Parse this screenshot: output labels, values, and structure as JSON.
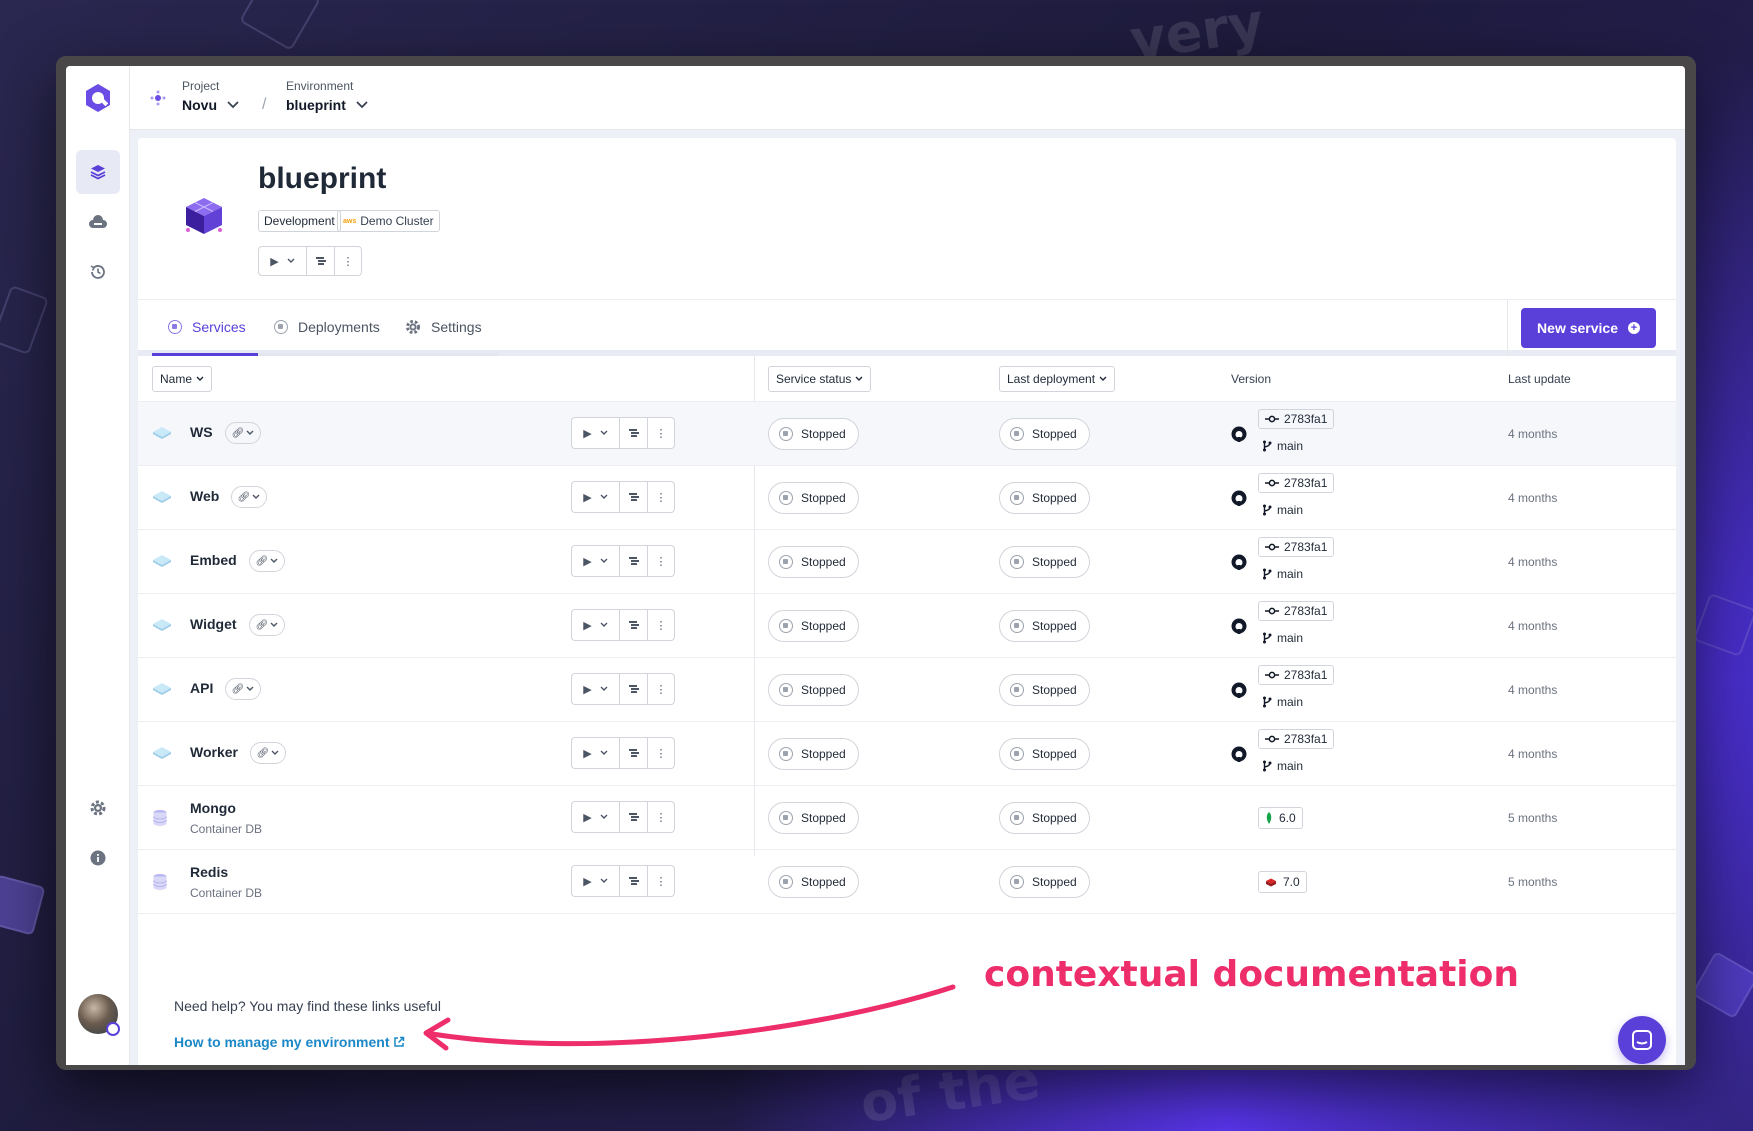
{
  "topbar": {
    "project_label": "Project",
    "project_value": "Novu",
    "separator": "/",
    "environment_label": "Environment",
    "environment_value": "blueprint"
  },
  "header": {
    "title": "blueprint",
    "tag_env": "Development",
    "tag_cluster_icon": "aws",
    "tag_cluster": "Demo Cluster"
  },
  "tabs": [
    {
      "label": "Services",
      "icon": "service-icon",
      "active": true
    },
    {
      "label": "Deployments",
      "icon": "deployment-icon",
      "active": false
    },
    {
      "label": "Settings",
      "icon": "gear-icon",
      "active": false
    }
  ],
  "new_service_label": "New service",
  "columns": {
    "name": "Name",
    "service_status": "Service status",
    "last_deployment": "Last deployment",
    "version": "Version",
    "last_update": "Last update"
  },
  "services": [
    {
      "name": "WS",
      "subtitle": "",
      "service_status": "Stopped",
      "deployment_status": "Stopped",
      "commit": "2783fa1",
      "branch": "main",
      "updated": "4 months"
    },
    {
      "name": "Web",
      "subtitle": "",
      "service_status": "Stopped",
      "deployment_status": "Stopped",
      "commit": "2783fa1",
      "branch": "main",
      "updated": "4 months"
    },
    {
      "name": "Embed",
      "subtitle": "",
      "service_status": "Stopped",
      "deployment_status": "Stopped",
      "commit": "2783fa1",
      "branch": "main",
      "updated": "4 months"
    },
    {
      "name": "Widget",
      "subtitle": "",
      "service_status": "Stopped",
      "deployment_status": "Stopped",
      "commit": "2783fa1",
      "branch": "main",
      "updated": "4 months"
    },
    {
      "name": "API",
      "subtitle": "",
      "service_status": "Stopped",
      "deployment_status": "Stopped",
      "commit": "2783fa1",
      "branch": "main",
      "updated": "4 months"
    },
    {
      "name": "Worker",
      "subtitle": "",
      "service_status": "Stopped",
      "deployment_status": "Stopped",
      "commit": "2783fa1",
      "branch": "main",
      "updated": "4 months"
    },
    {
      "name": "Mongo",
      "subtitle": "Container DB",
      "service_status": "Stopped",
      "deployment_status": "Stopped",
      "db_version": "6.0",
      "updated": "5 months"
    },
    {
      "name": "Redis",
      "subtitle": "Container DB",
      "service_status": "Stopped",
      "deployment_status": "Stopped",
      "db_version": "7.0",
      "updated": "5 months"
    }
  ],
  "help": {
    "intro": "Need help? You may find these links useful",
    "link": "How to manage my environment"
  },
  "annotation": "contextual documentation",
  "colors": {
    "accent": "#5b3fd9",
    "link": "#1c88c7",
    "annotation": "#ee2d6b"
  }
}
